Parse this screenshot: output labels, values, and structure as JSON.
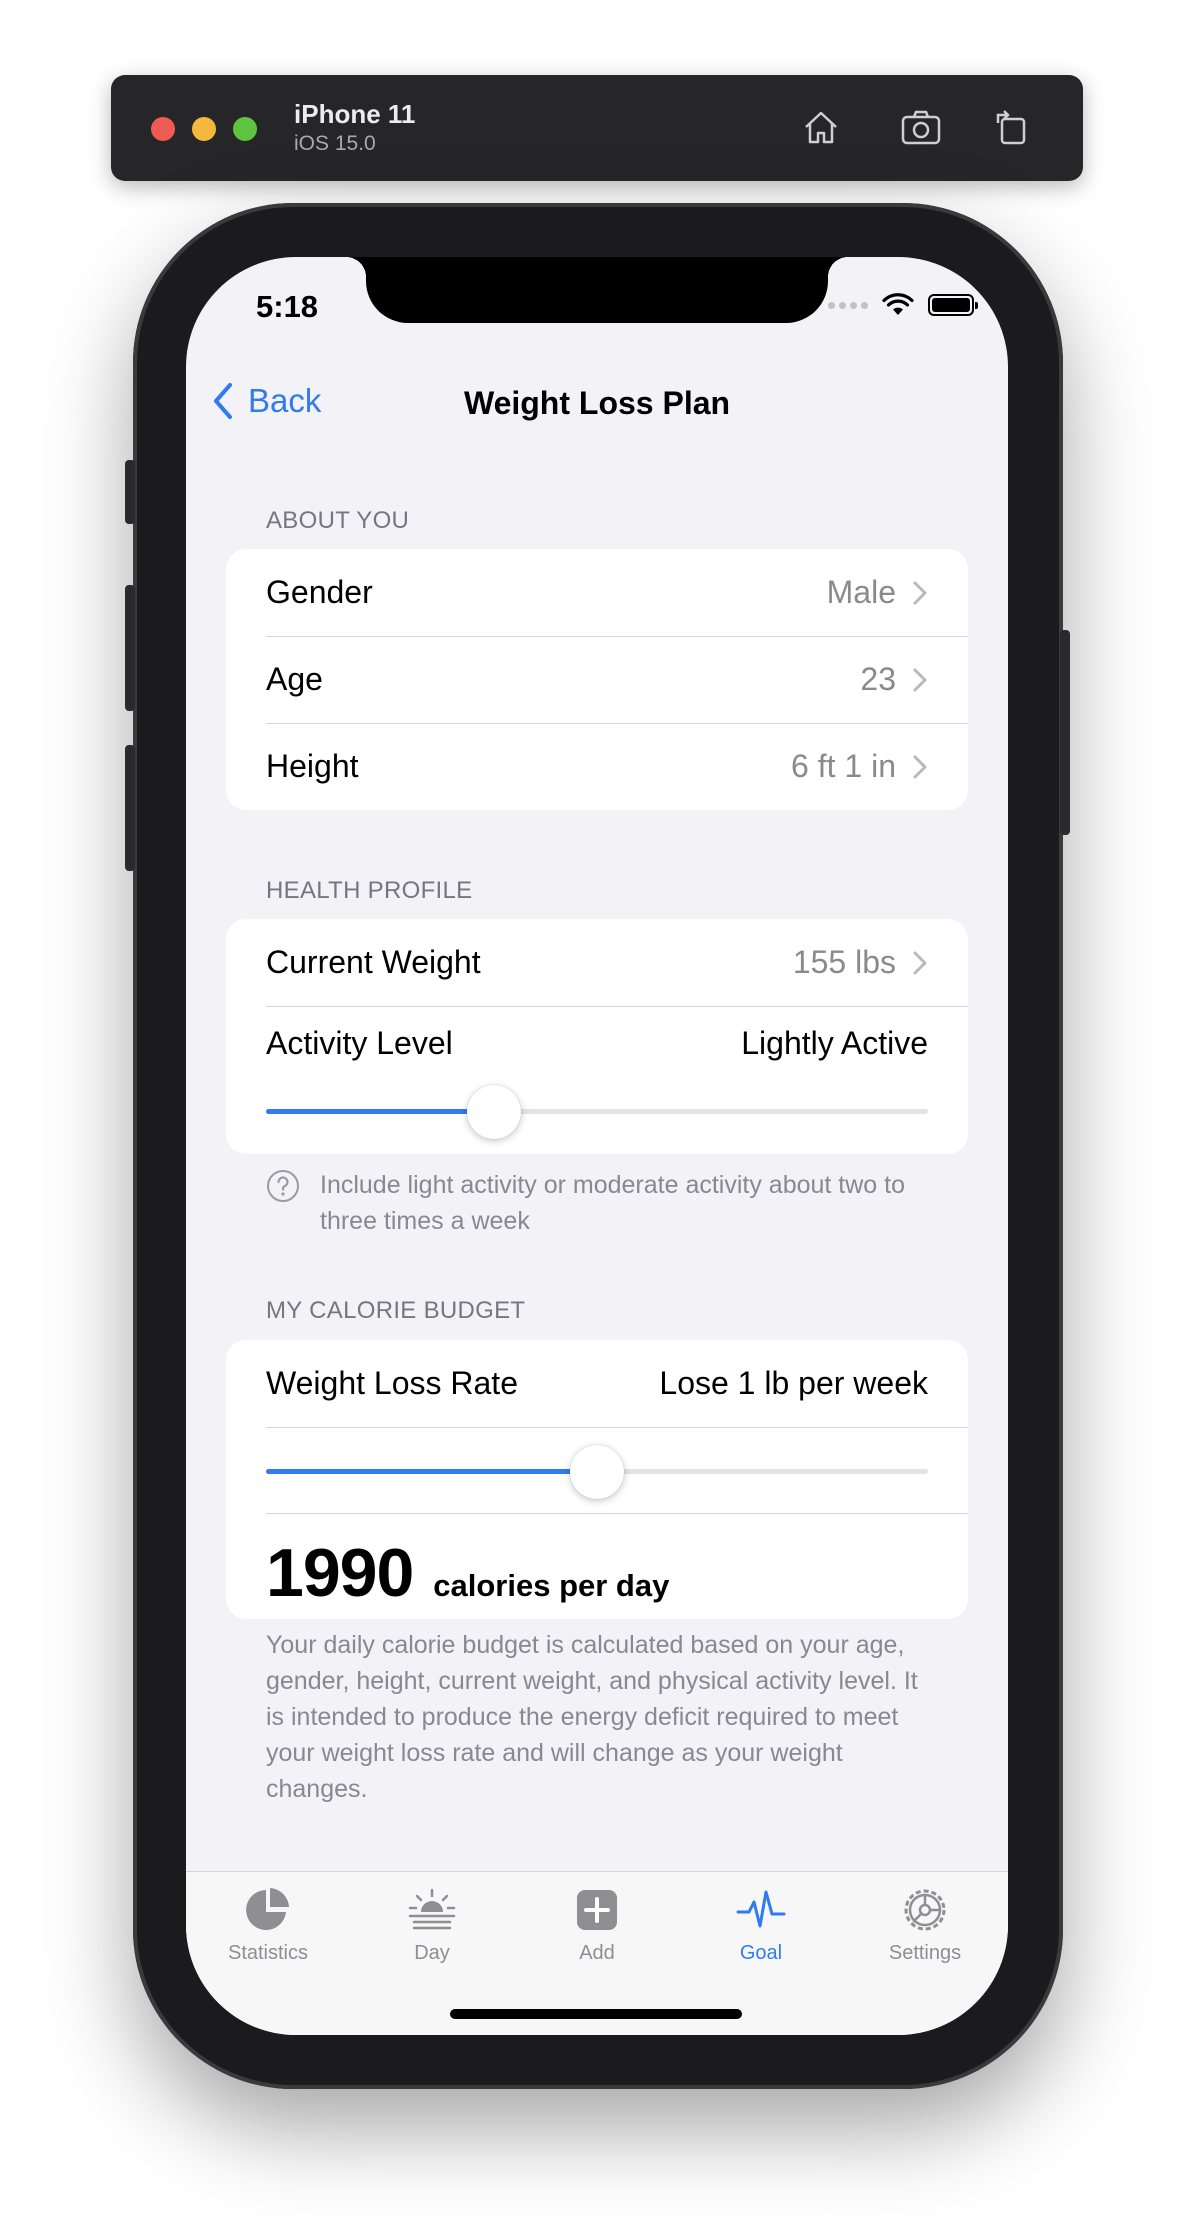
{
  "simulator": {
    "device_name": "iPhone 11",
    "os_version": "iOS 15.0",
    "toolbar_icons": [
      "home-icon",
      "screenshot-icon",
      "rotate-icon"
    ]
  },
  "status_bar": {
    "time": "5:18",
    "icons": [
      "cellular-icon",
      "wifi-icon",
      "battery-icon"
    ]
  },
  "nav": {
    "back_label": "Back",
    "title": "Weight Loss Plan"
  },
  "about_you": {
    "header": "ABOUT YOU",
    "rows": [
      {
        "label": "Gender",
        "value": "Male"
      },
      {
        "label": "Age",
        "value": "23"
      },
      {
        "label": "Height",
        "value": "6 ft 1 in"
      }
    ]
  },
  "health_profile": {
    "header": "HEALTH PROFILE",
    "current_weight": {
      "label": "Current Weight",
      "value": "155 lbs"
    },
    "activity_level": {
      "label": "Activity Level",
      "value": "Lightly Active",
      "slider_fraction": 0.345
    },
    "help_text": "Include light activity or moderate activity about two to three times a week"
  },
  "calorie_budget": {
    "header": "MY CALORIE BUDGET",
    "weight_loss_rate": {
      "label": "Weight Loss Rate",
      "value": "Lose 1 lb per week",
      "slider_fraction": 0.5
    },
    "calories": "1990",
    "calories_unit": "calories per day",
    "footnote": "Your daily calorie budget is calculated based on your age, gender, height, current weight, and physical activity level. It is intended to produce the energy deficit required to meet your weight loss rate and will change as your weight changes."
  },
  "tabs": [
    {
      "label": "Statistics",
      "icon": "pie-chart-icon",
      "active": false
    },
    {
      "label": "Day",
      "icon": "sunrise-icon",
      "active": false
    },
    {
      "label": "Add",
      "icon": "plus-square-icon",
      "active": false
    },
    {
      "label": "Goal",
      "icon": "heartbeat-icon",
      "active": true
    },
    {
      "label": "Settings",
      "icon": "gear-icon",
      "active": false
    }
  ],
  "colors": {
    "accent": "#2f7bf0",
    "background": "#f2f2f7",
    "secondary_text": "#8a8a8e"
  }
}
